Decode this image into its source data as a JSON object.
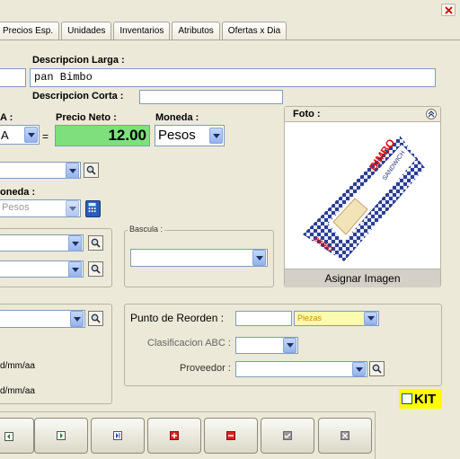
{
  "tabs": [
    "Precios Esp.",
    "Unidades",
    "Inventarios",
    "Atributos",
    "Ofertas x Dia"
  ],
  "labels": {
    "descripcion_larga": "Descripcion Larga :",
    "descripcion_corta": "Descripcion Corta :",
    "iva_partial": "A :",
    "precio_neto": "Precio Neto :",
    "moneda": "Moneda :",
    "moneda2_partial": "oneda :",
    "foto": "Foto :",
    "bascula": "Bascula :",
    "punto_reorden": "Punto de Reorden :",
    "clasificacion_abc": "Clasificacion ABC :",
    "proveedor": "Proveedor :",
    "date1": "d/mm/aa",
    "date2": "d/mm/aa",
    "kit": "KIT"
  },
  "fields": {
    "descripcion_larga": "pan Bimbo",
    "descripcion_corta": "",
    "iva_value": "A",
    "precio_neto": "12.00",
    "moneda": "Pesos",
    "moneda2": "Pesos",
    "punto_reorden": "",
    "unidad_reorden": "Piezas",
    "clasificacion_abc": "",
    "proveedor": "",
    "bascula": ""
  },
  "image": {
    "assign_button": "Asignar Imagen",
    "brand": "BIMBO",
    "subtitle": "SANDWICH"
  },
  "colors": {
    "precio_bg": "#7de07d",
    "piezas_bg": "#fbfbb0",
    "kit_bg": "#ffff00"
  },
  "toolbar": [
    {
      "icon": "first-record-icon",
      "color": "#1a8a1a"
    },
    {
      "icon": "next-record-icon",
      "color": "#1a8a1a"
    },
    {
      "icon": "last-record-icon",
      "color": "#1a4fb0"
    },
    {
      "icon": "add-record-icon",
      "color": "#d11"
    },
    {
      "icon": "delete-record-icon",
      "color": "#d11"
    },
    {
      "icon": "accept-icon",
      "color": "#888"
    },
    {
      "icon": "cancel-icon",
      "color": "#888"
    }
  ]
}
